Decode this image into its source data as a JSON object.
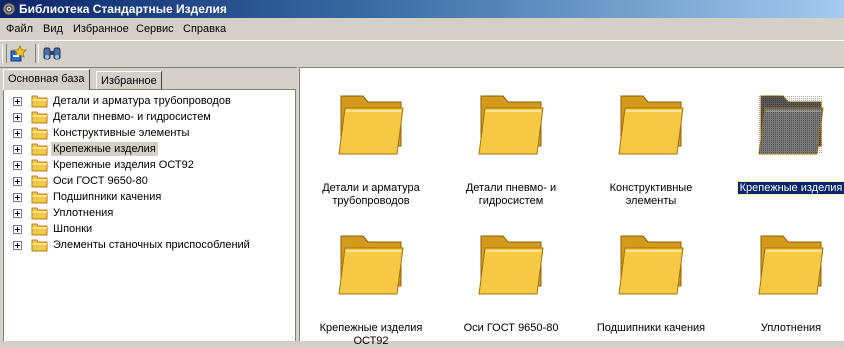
{
  "window": {
    "title": "Библиотека Стандартные Изделия"
  },
  "menu": [
    "Файл",
    "Вид",
    "Избранное",
    "Сервис",
    "Справка"
  ],
  "toolbar": {
    "buttons": [
      "wizard-icon",
      "binoculars-icon"
    ]
  },
  "tabs": [
    "Основная база",
    "Избранное"
  ],
  "tree": [
    {
      "label": "Детали и арматура трубопроводов",
      "selected": false
    },
    {
      "label": "Детали пневмо- и гидросистем",
      "selected": false
    },
    {
      "label": "Конструктивные элементы",
      "selected": false
    },
    {
      "label": "Крепежные изделия",
      "selected": true
    },
    {
      "label": "Крепежные изделия ОСТ92",
      "selected": false
    },
    {
      "label": "Оси ГОСТ 9650-80",
      "selected": false
    },
    {
      "label": "Подшипники качения",
      "selected": false
    },
    {
      "label": "Уплотнения",
      "selected": false
    },
    {
      "label": "Шпонки",
      "selected": false
    },
    {
      "label": "Элементы станочных приспособлений",
      "selected": false
    }
  ],
  "icons": [
    {
      "lines": [
        "Детали и арматура",
        "трубопроводов"
      ],
      "selected": false
    },
    {
      "lines": [
        "Детали пневмо- и",
        "гидросистем"
      ],
      "selected": false
    },
    {
      "lines": [
        "Конструктивные",
        "элементы"
      ],
      "selected": false
    },
    {
      "lines": [
        "Крепежные изделия"
      ],
      "selected": true
    },
    {
      "lines": [
        "Крепежные изделия",
        "ОСТ92"
      ],
      "selected": false
    },
    {
      "lines": [
        "Оси ГОСТ 9650-80"
      ],
      "selected": false
    },
    {
      "lines": [
        "Подшипники качения"
      ],
      "selected": false
    },
    {
      "lines": [
        "Уплотнения"
      ],
      "selected": false
    }
  ],
  "colors": {
    "folder": "#f2c94c",
    "folder_dark": "#d49a1c",
    "selection": "#0a246a",
    "titlebar": "#0a246a"
  }
}
